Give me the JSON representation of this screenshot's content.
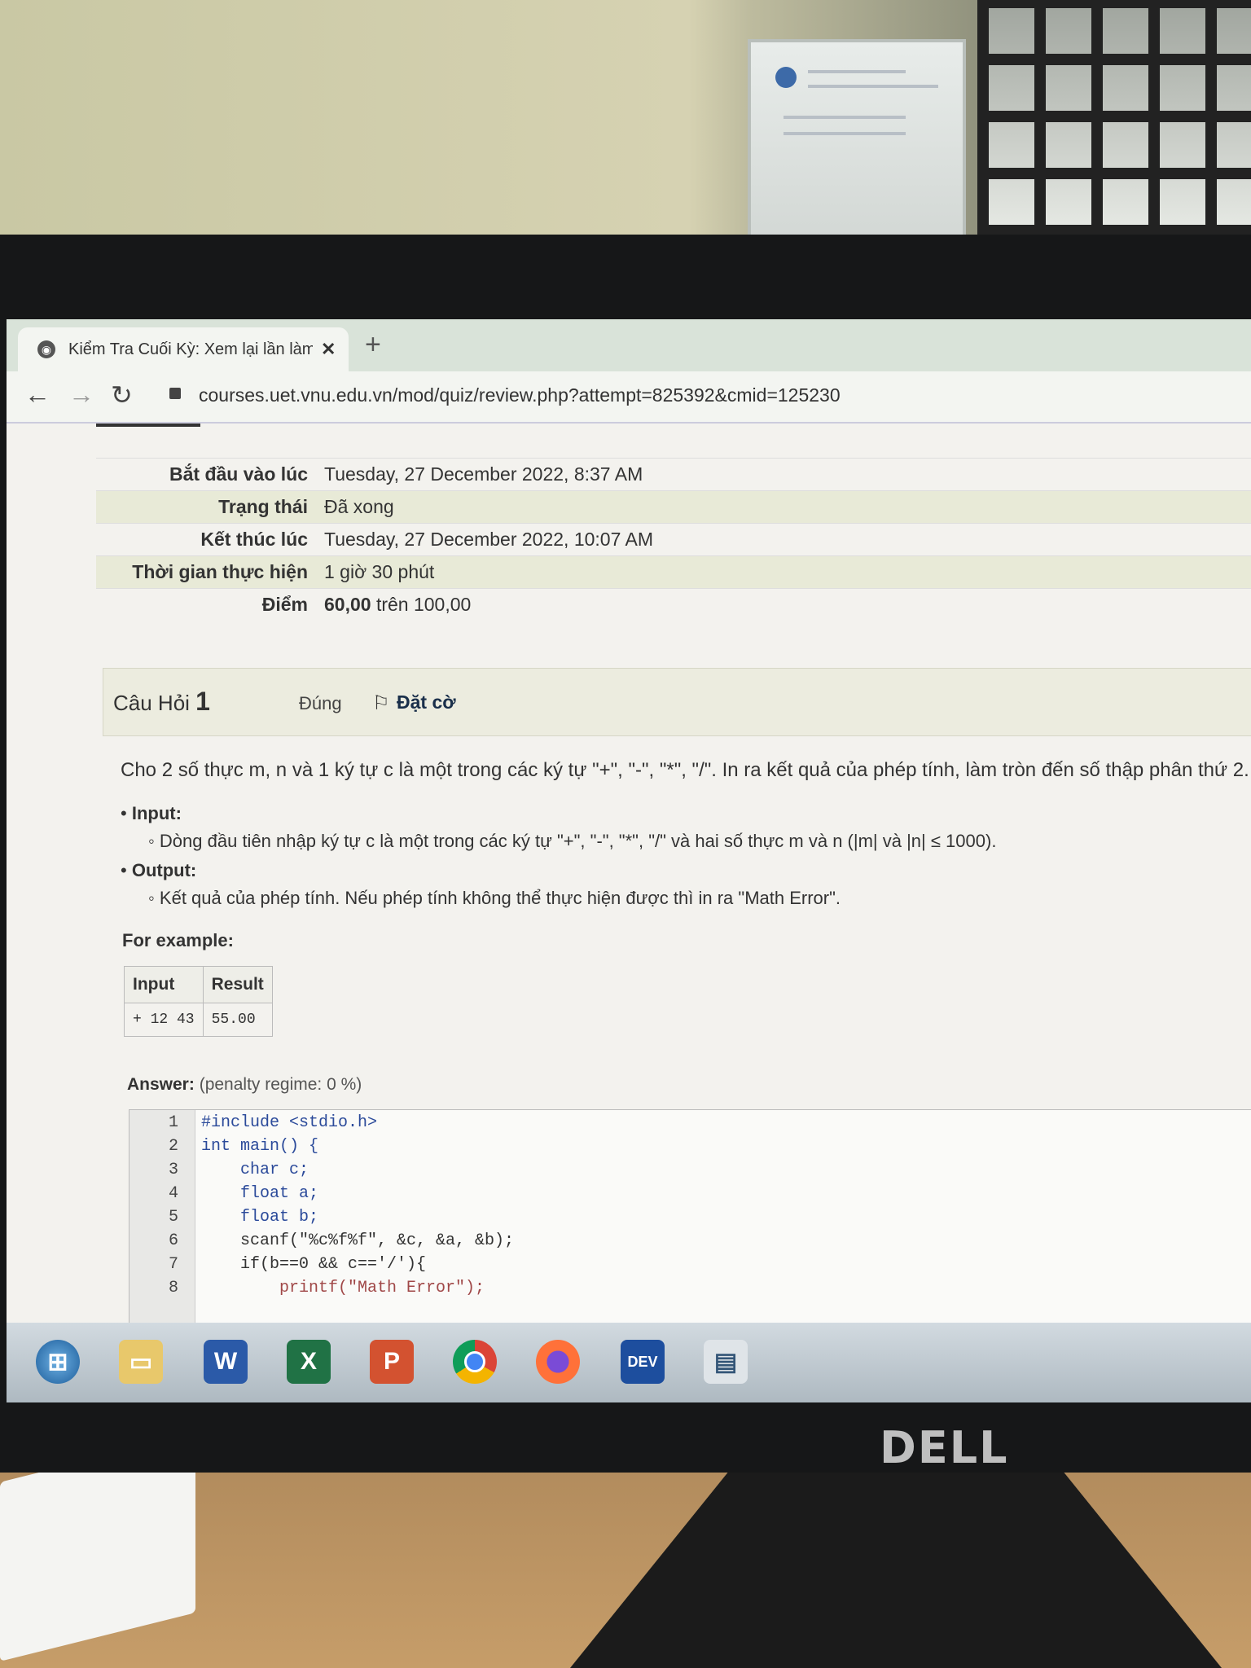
{
  "browser": {
    "tab_title": "Kiểm Tra Cuối Kỳ: Xem lại lần làm",
    "new_tab": "+",
    "url": "courses.uet.vnu.edu.vn/mod/quiz/review.php?attempt=825392&cmid=125230"
  },
  "summary": [
    {
      "label": "Bắt đầu vào lúc",
      "value": "Tuesday, 27 December 2022, 8:37 AM"
    },
    {
      "label": "Trạng thái",
      "value": "Đã xong"
    },
    {
      "label": "Kết thúc lúc",
      "value": "Tuesday, 27 December 2022, 10:07 AM"
    },
    {
      "label": "Thời gian thực hiện",
      "value": "1 giờ 30 phút"
    },
    {
      "label": "Điểm",
      "value_bold": "60,00",
      "value_rest": "trên 100,00"
    }
  ],
  "question": {
    "title": "Câu Hỏi",
    "number": "1",
    "status": "Đúng",
    "flag_label": "Đặt cờ",
    "text": "Cho 2 số thực m, n và 1 ký tự c là một trong các ký tự \"+\", \"-\", \"*\", \"/\". In ra kết quả của phép tính, làm tròn đến số thập phân thứ 2.",
    "input_label": "Input:",
    "input_desc": "Dòng đầu tiên nhập ký tự c là một trong các ký tự \"+\", \"-\", \"*\", \"/\" và hai số thực m và n (|m| và |n| ≤ 1000).",
    "output_label": "Output:",
    "output_desc": "Kết quả của phép tính. Nếu phép tính không thể thực hiện được thì in ra \"Math Error\".",
    "example_label": "For example:",
    "example_headers": [
      "Input",
      "Result"
    ],
    "example_row": [
      "+ 12 43",
      "55.00"
    ],
    "answer_label": "Answer:",
    "answer_note": "(penalty regime: 0 %)"
  },
  "code_lines": [
    {
      "n": "1",
      "text": "#include <stdio.h>"
    },
    {
      "n": "2",
      "text": "int main() {"
    },
    {
      "n": "3",
      "text": "    char c;"
    },
    {
      "n": "4",
      "text": "    float a;"
    },
    {
      "n": "5",
      "text": "    float b;"
    },
    {
      "n": "6",
      "text": "    scanf(\"%c%f%f\", &c, &a, &b);"
    },
    {
      "n": "7",
      "text": "    if(b==0 && c=='/'){"
    },
    {
      "n": "8",
      "text": "        printf(\"Math Error\");"
    }
  ],
  "taskbar_icons": [
    "start-icon",
    "file-explorer-icon",
    "word-icon",
    "excel-icon",
    "powerpoint-icon",
    "chrome-icon",
    "firefox-icon",
    "dev-cpp-icon",
    "window-icon"
  ],
  "monitor_brand": "DELL",
  "colors": {
    "accent": "#1a2f4a",
    "row_alt": "#e8ead7",
    "taskbar": "#c4ced5"
  }
}
